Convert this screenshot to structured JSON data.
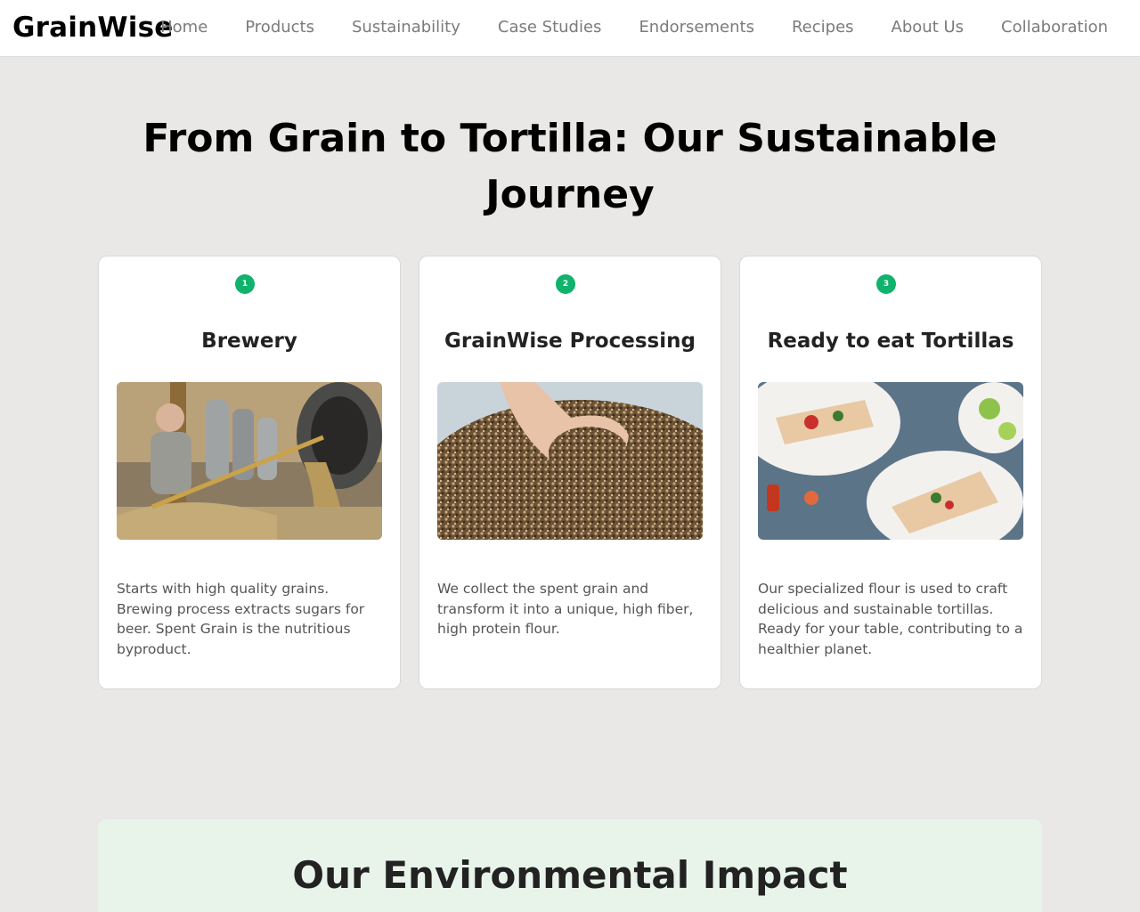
{
  "brand": {
    "logo": "GrainWise"
  },
  "nav": {
    "items": [
      "Home",
      "Products",
      "Sustainability",
      "Case Studies",
      "Endorsements",
      "Recipes",
      "About Us",
      "Collaboration"
    ]
  },
  "hero": {
    "title": "From Grain to Tortilla: Our Sustainable Journey"
  },
  "steps": [
    {
      "number": "1",
      "title": "Brewery",
      "image": "brewer-shoveling-spent-grain-photo",
      "description": "Starts with high quality grains. Brewing process extracts sugars for beer. Spent Grain is the nutritious byproduct."
    },
    {
      "number": "2",
      "title": "GrainWise Processing",
      "image": "hand-holding-spent-grain-photo",
      "description": "We collect the spent grain and transform it into a unique, high fiber, high protein flour."
    },
    {
      "number": "3",
      "title": "Ready to eat Tortillas",
      "image": "tortilla-wraps-on-plates-photo",
      "description": "Our specialized flour is used to craft delicious and sustainable tortillas. Ready for your table, contributing to a healthier planet."
    }
  ],
  "impact": {
    "title": "Our Environmental Impact"
  },
  "colors": {
    "accent": "#10b26c",
    "page_background": "#eae8e6",
    "impact_background": "#e8f4e9"
  }
}
